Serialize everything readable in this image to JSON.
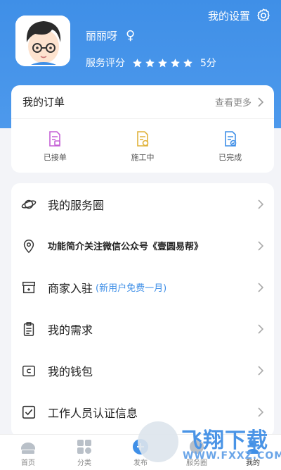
{
  "header": {
    "settings_label": "我的设置",
    "user_name": "丽丽呀",
    "gender_symbol": "♀",
    "rating_label": "服务评分",
    "rating_value": 5,
    "rating_text": "5分"
  },
  "orders": {
    "title": "我的订单",
    "more_label": "查看更多",
    "items": [
      {
        "label": "已接单",
        "icon": "order-accepted-icon",
        "color": "#c561d6"
      },
      {
        "label": "施工中",
        "icon": "order-in-progress-icon",
        "color": "#e0b23a"
      },
      {
        "label": "已完成",
        "icon": "order-completed-icon",
        "color": "#3f8fe7"
      }
    ]
  },
  "menu": {
    "items": [
      {
        "label": "我的服务圈",
        "icon": "planet-icon"
      },
      {
        "label": "功能简介关注微信公众号《壹圆易帮》",
        "icon": "location-pin-icon"
      },
      {
        "label": "商家入驻",
        "note": "(新用户免费一月)",
        "icon": "store-icon"
      },
      {
        "label": "我的需求",
        "icon": "clipboard-icon"
      },
      {
        "label": "我的钱包",
        "icon": "wallet-icon"
      },
      {
        "label": "工作人员认证信息",
        "icon": "checkbox-icon"
      }
    ]
  },
  "tabbar": {
    "items": [
      {
        "label": "首页",
        "icon": "home-icon"
      },
      {
        "label": "分类",
        "icon": "category-icon"
      },
      {
        "label": "发布",
        "icon": "publish-icon"
      },
      {
        "label": "服务圈",
        "icon": "service-circle-icon"
      },
      {
        "label": "我的",
        "icon": "profile-icon"
      }
    ]
  },
  "watermark": {
    "text": "飞翔下载",
    "url": "WWW.FXXZ.COM"
  },
  "colors": {
    "primary": "#3f8fe7",
    "star": "#ffffff",
    "background": "#f3f4f8"
  }
}
